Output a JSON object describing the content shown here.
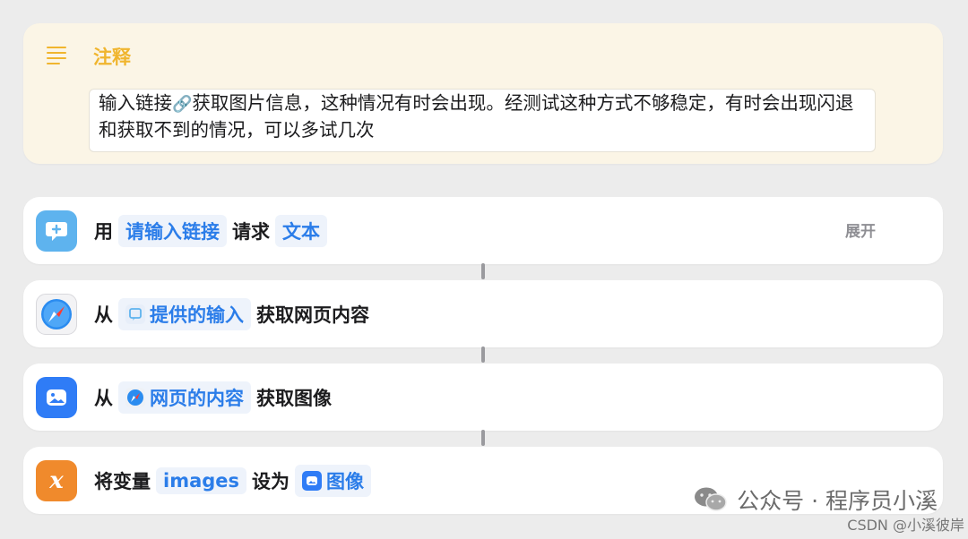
{
  "comment": {
    "title": "注释",
    "text_part1": "输入链接",
    "text_part2": "获取图片信息，这种情况有时会出现。经测试这种方式不够稳定，有时会出现闪退和获取不到的情况，可以多试几次",
    "link_emoji": "🔗"
  },
  "actions": [
    {
      "verb1": "用",
      "param1": "请输入链接",
      "verb2": "请求",
      "param2": "文本",
      "expand": "展开",
      "icon": "ask-for-input-icon"
    },
    {
      "verb1": "从",
      "param1": "提供的输入",
      "verb2": "获取网页内容",
      "icon": "safari-icon"
    },
    {
      "verb1": "从",
      "param1": "网页的内容",
      "verb2": "获取图像",
      "icon": "image-icon"
    },
    {
      "verb1": "将变量",
      "param1": "images",
      "verb2": "设为",
      "param2": "图像",
      "icon": "variable-x-icon",
      "icon_glyph": "x"
    }
  ],
  "watermark": {
    "text": "公众号 · 程序员小溪",
    "sub": "CSDN @小溪彼岸"
  },
  "colors": {
    "accent_blue": "#2b7de9",
    "comment_yellow": "#f0b52e",
    "variable_orange": "#f08a2c"
  }
}
